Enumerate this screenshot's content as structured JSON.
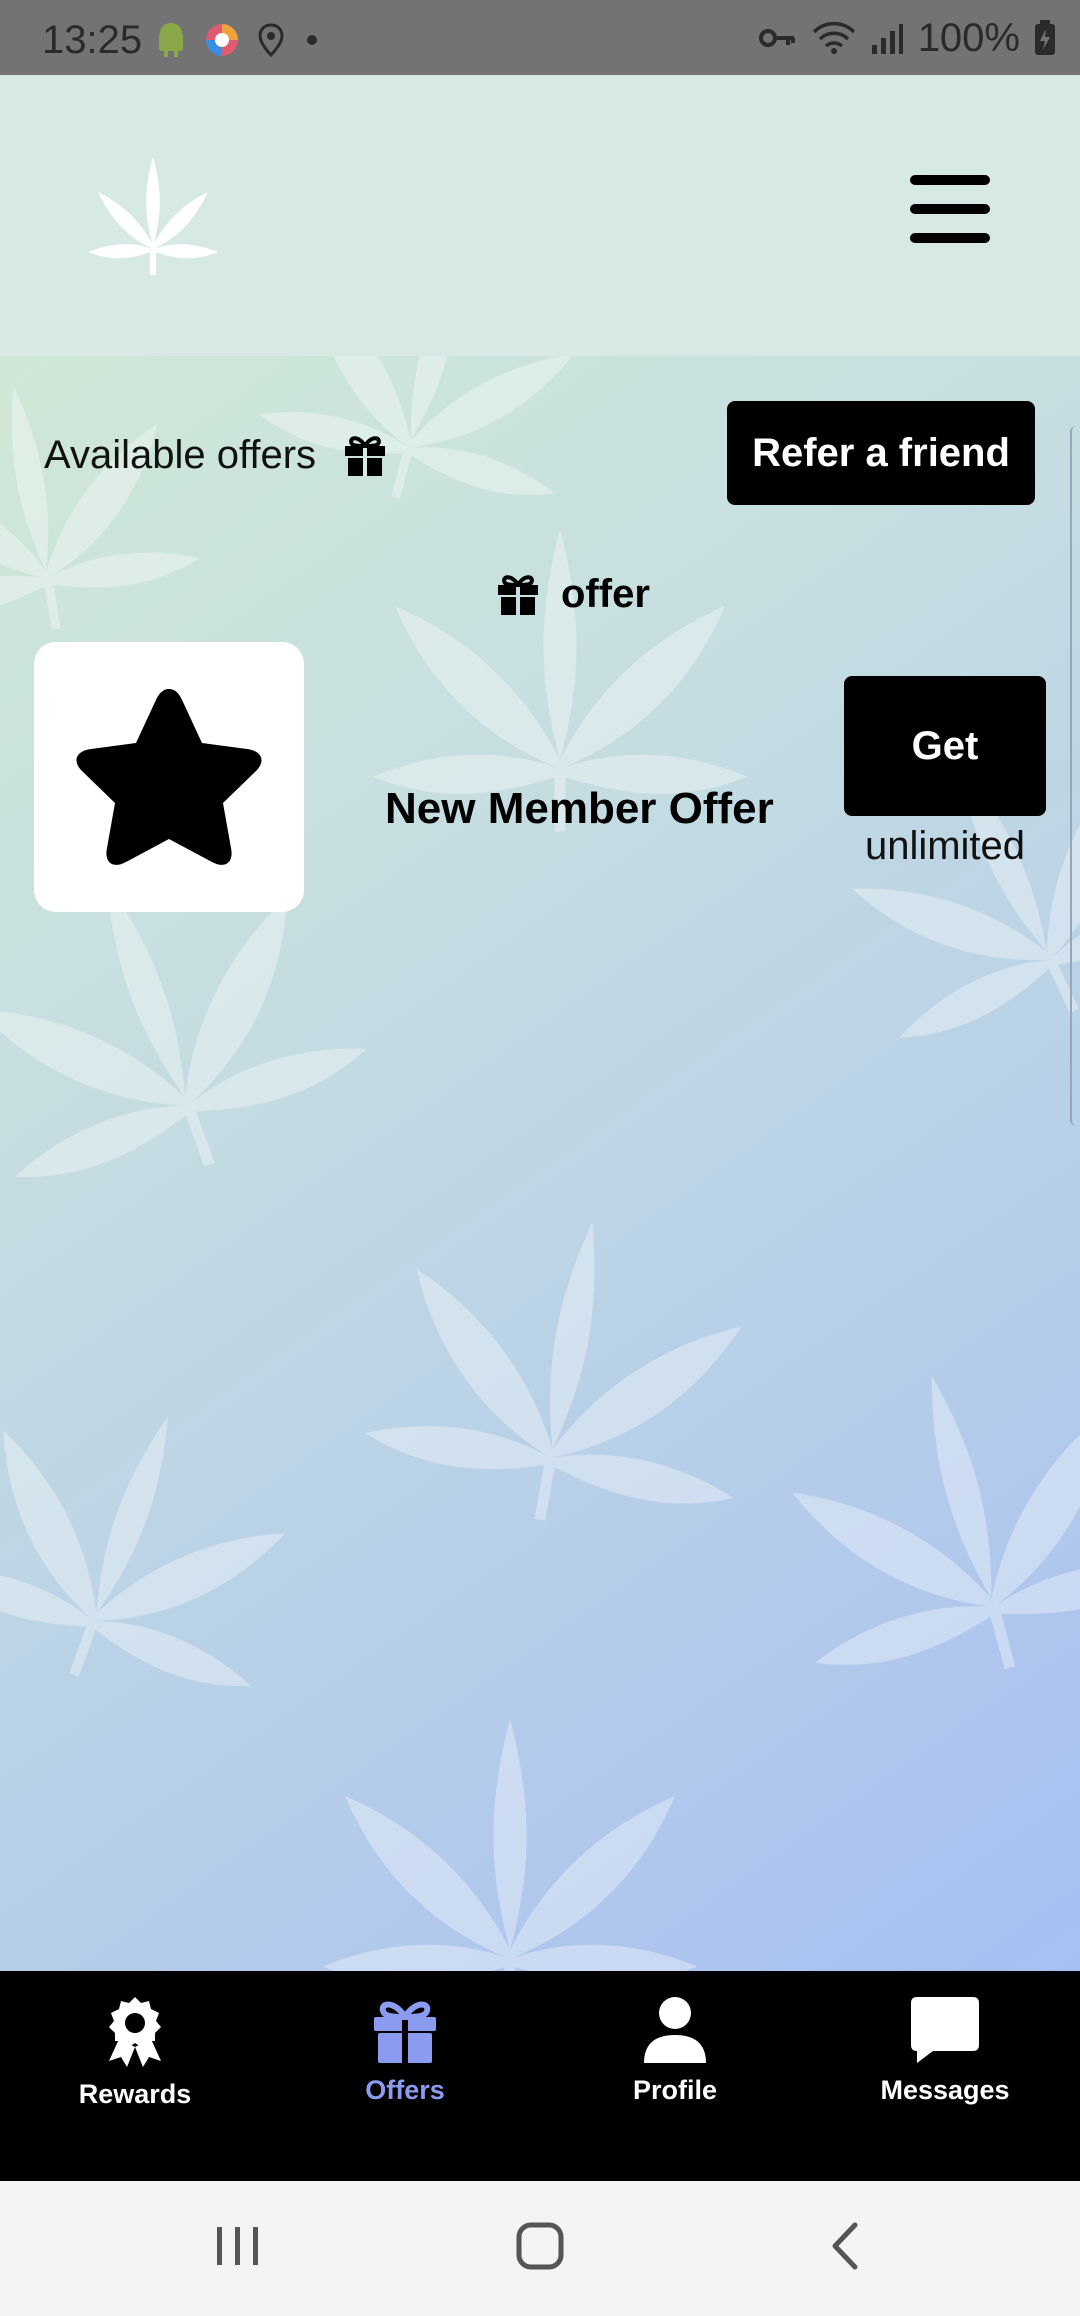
{
  "status_bar": {
    "time": "13:25",
    "battery": "100%",
    "icons": [
      "android-icon",
      "browser-icon",
      "location-icon",
      "dot-icon",
      "vpn-key-icon",
      "wifi-icon",
      "signal-icon",
      "battery-icon"
    ]
  },
  "header": {
    "logo_icon": "leaf-logo-icon",
    "menu_icon": "hamburger-menu-icon"
  },
  "offers_section": {
    "title": "Available offers",
    "refer_label": "Refer a friend",
    "offer_heading": "offer",
    "offers": [
      {
        "name": "New Member Offer",
        "icon": "star-icon",
        "action_label": "Get",
        "limit": "unlimited"
      }
    ]
  },
  "bottom_nav": {
    "items": [
      {
        "label": "Rewards",
        "icon": "award-icon",
        "active": false
      },
      {
        "label": "Offers",
        "icon": "gift-icon",
        "active": true
      },
      {
        "label": "Profile",
        "icon": "user-icon",
        "active": false
      },
      {
        "label": "Messages",
        "icon": "message-icon",
        "active": false
      }
    ]
  },
  "colors": {
    "active_nav": "#8b9cf0",
    "header_bg": "#d6e9e4",
    "button_bg": "#000000"
  }
}
